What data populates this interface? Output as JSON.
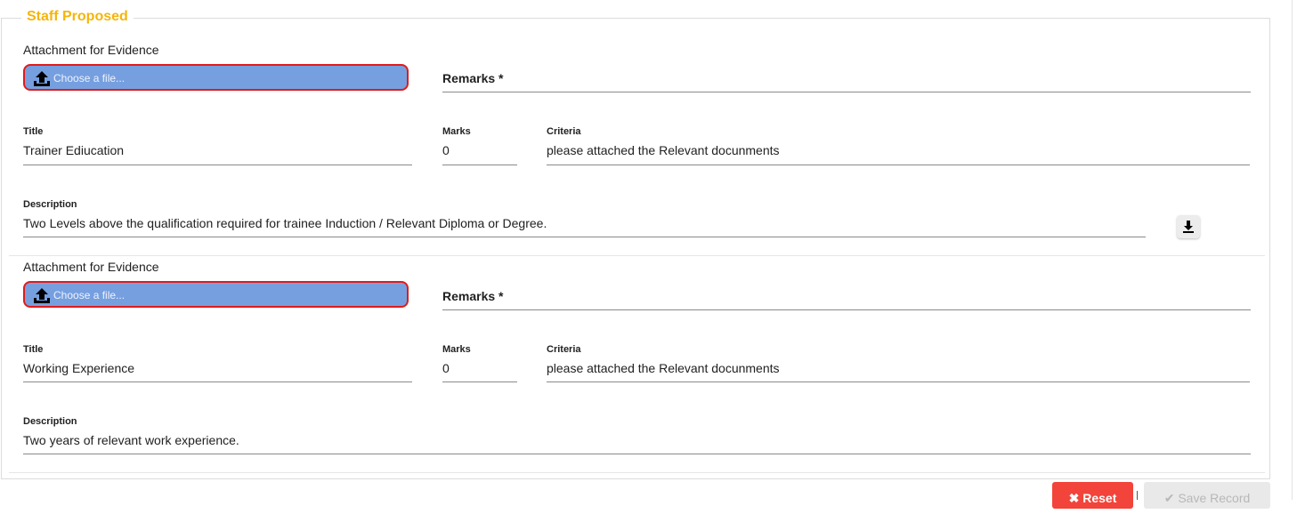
{
  "section": {
    "legend": "Staff Proposed"
  },
  "records": [
    {
      "attachment_label": "Attachment for Evidence",
      "file_placeholder": "Choose a file...",
      "remarks_label": "Remarks *",
      "title_label": "Title",
      "title_value": "Trainer Ediucation",
      "marks_label": "Marks",
      "marks_value": "0",
      "criteria_label": "Criteria",
      "criteria_value": "please attached the Relevant docunments",
      "description_label": "Description",
      "description_value": "Two Levels above the qualification required for trainee Induction / Relevant Diploma or Degree."
    },
    {
      "attachment_label": "Attachment for Evidence",
      "file_placeholder": "Choose a file...",
      "remarks_label": "Remarks *",
      "title_label": "Title",
      "title_value": "Working Experience",
      "marks_label": "Marks",
      "marks_value": "0",
      "criteria_label": "Criteria",
      "criteria_value": "please attached the Relevant docunments",
      "description_label": "Description",
      "description_value": "Two years of relevant work experience."
    }
  ],
  "actions": {
    "reset_label": "✖ Reset",
    "save_label": "✔ Save Record"
  },
  "colors": {
    "legend": "#f5b50a",
    "file_button": "#769fe0",
    "file_border": "#e01b1b",
    "reset": "#f2443a"
  },
  "icons": {
    "upload": "upload-icon",
    "download": "download-icon"
  }
}
